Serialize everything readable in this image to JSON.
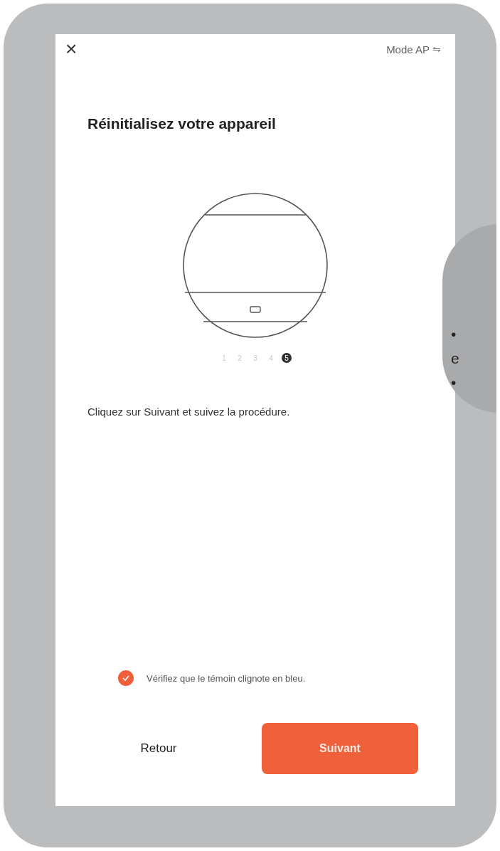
{
  "header": {
    "close": "×",
    "mode_label": "Mode AP",
    "mode_icon": "⇋"
  },
  "title": "Réinitialisez votre appareil",
  "steps": [
    {
      "label": "1",
      "selected": false
    },
    {
      "label": "2",
      "selected": false
    },
    {
      "label": "3",
      "selected": false
    },
    {
      "label": "4",
      "selected": false
    },
    {
      "label": "5",
      "selected": true
    }
  ],
  "instruction": "Cliquez sur Suivant et suivez la procédure.",
  "confirm": {
    "label": "Vérifiez que le témoin clignote en bleu.",
    "checked": true
  },
  "buttons": {
    "back": "Retour",
    "next": "Suivant"
  },
  "side_callout": {
    "lines": [
      "•",
      "e",
      "•"
    ]
  }
}
